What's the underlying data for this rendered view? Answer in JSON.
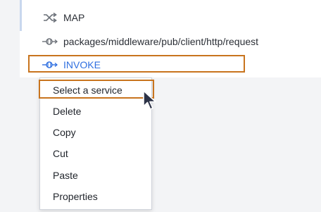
{
  "flow": {
    "steps": [
      {
        "label": "MAP",
        "icon": "map-shuffle-icon"
      },
      {
        "label": "packages/middleware/pub/client/http/request",
        "icon": "invoke-icon"
      },
      {
        "label": "INVOKE",
        "icon": "invoke-icon",
        "selected": true
      }
    ]
  },
  "context_menu": {
    "items": [
      {
        "label": "Select a service",
        "highlighted": true
      },
      {
        "label": "Delete"
      },
      {
        "label": "Copy"
      },
      {
        "label": "Cut"
      },
      {
        "label": "Paste"
      },
      {
        "label": "Properties"
      }
    ]
  },
  "colors": {
    "selected_text": "#2f6fe0",
    "highlight_border": "#c8741e",
    "icon_gray": "#6b7078"
  }
}
